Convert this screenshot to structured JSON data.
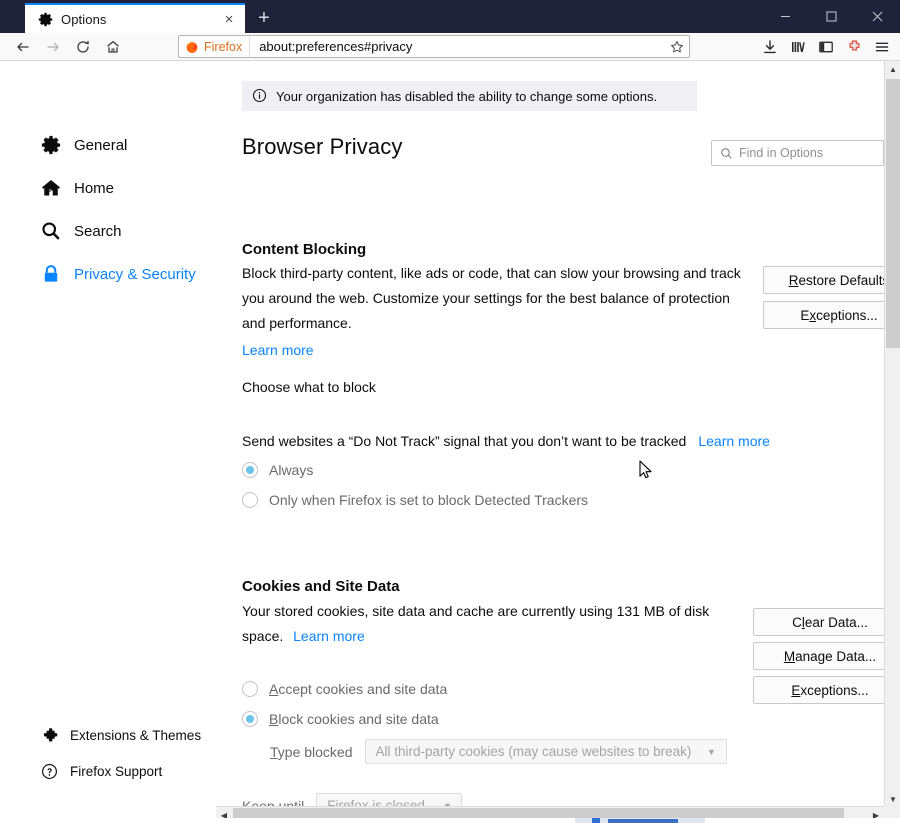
{
  "window": {
    "controls": {
      "minimize": "minimize-icon",
      "maximize": "maximize-icon",
      "close": "close-icon"
    }
  },
  "tabbar": {
    "tabs": [
      {
        "title": "Options",
        "favicon": "gear-icon",
        "close_label": "×",
        "active": true
      }
    ],
    "new_tab_label": "+"
  },
  "toolbar": {
    "back": "back-arrow-icon",
    "forward": "forward-arrow-icon",
    "reload": "reload-icon",
    "home": "home-icon",
    "identity_label": "Firefox",
    "url": "about:preferences#privacy",
    "bookmark_star": "star-icon",
    "right_icons": [
      "downloads-icon",
      "library-icon",
      "sidebar-icon",
      "addon-icon",
      "menu-icon"
    ]
  },
  "notification": {
    "icon": "info-icon",
    "text": "Your organization has disabled the ability to change some options."
  },
  "search": {
    "icon": "search-icon",
    "placeholder": "Find in Options"
  },
  "sidebar": {
    "items": [
      {
        "label": "General",
        "icon": "gear-icon",
        "selected": false
      },
      {
        "label": "Home",
        "icon": "home-icon",
        "selected": false
      },
      {
        "label": "Search",
        "icon": "search-icon",
        "selected": false
      },
      {
        "label": "Privacy & Security",
        "icon": "lock-icon",
        "selected": true
      }
    ],
    "footer_items": [
      {
        "label": "Extensions & Themes",
        "icon": "puzzle-icon"
      },
      {
        "label": "Firefox Support",
        "icon": "question-circle-icon"
      }
    ]
  },
  "page": {
    "title": "Browser Privacy",
    "content_blocking": {
      "heading": "Content Blocking",
      "description": "Block third-party content, like ads or code, that can slow your browsing and track you around the web. Customize your settings for the best balance of protection and performance.",
      "learn_more": "Learn more",
      "choose_label": "Choose what to block",
      "restore_defaults_button": "Restore Defaults",
      "restore_defaults_accesskey": "R",
      "exceptions_button": "Exceptions...",
      "exceptions_accesskey": "x"
    },
    "do_not_track": {
      "description": "Send websites a “Do Not Track” signal that you don’t want to be tracked",
      "learn_more": "Learn more",
      "options": [
        {
          "label": "Always",
          "selected": true
        },
        {
          "label": "Only when Firefox is set to block Detected Trackers",
          "selected": false
        }
      ]
    },
    "cookies": {
      "heading": "Cookies and Site Data",
      "description_part1": "Your stored cookies, site data and cache are currently using 131 MB of disk",
      "description_part2": "space.",
      "disk_usage": "131 MB",
      "learn_more": "Learn more",
      "clear_data_button": "Clear Data...",
      "clear_data_accesskey": "l",
      "manage_data_button": "Manage Data...",
      "manage_data_accesskey": "M",
      "exceptions_button": "Exceptions...",
      "exceptions_accesskey": "E",
      "options": [
        {
          "label_pre": "",
          "accesskey": "A",
          "label_post": "ccept cookies and site data",
          "selected": false
        },
        {
          "label_pre": "",
          "accesskey": "B",
          "label_post": "lock cookies and site data",
          "selected": true
        }
      ],
      "type_blocked_label_pre": "",
      "type_blocked_accesskey": "T",
      "type_blocked_label_post": "ype blocked",
      "type_blocked_value": "All third-party cookies (may cause websites to break)",
      "keep_until_label_pre": "Keep ",
      "keep_until_accesskey": "u",
      "keep_until_label_post": "ntil",
      "keep_until_value": "Firefox is closed"
    }
  },
  "scrollbars": {
    "vertical_up": "▲",
    "vertical_down": "▼",
    "horizontal_left": "◀",
    "horizontal_right": "▶"
  }
}
